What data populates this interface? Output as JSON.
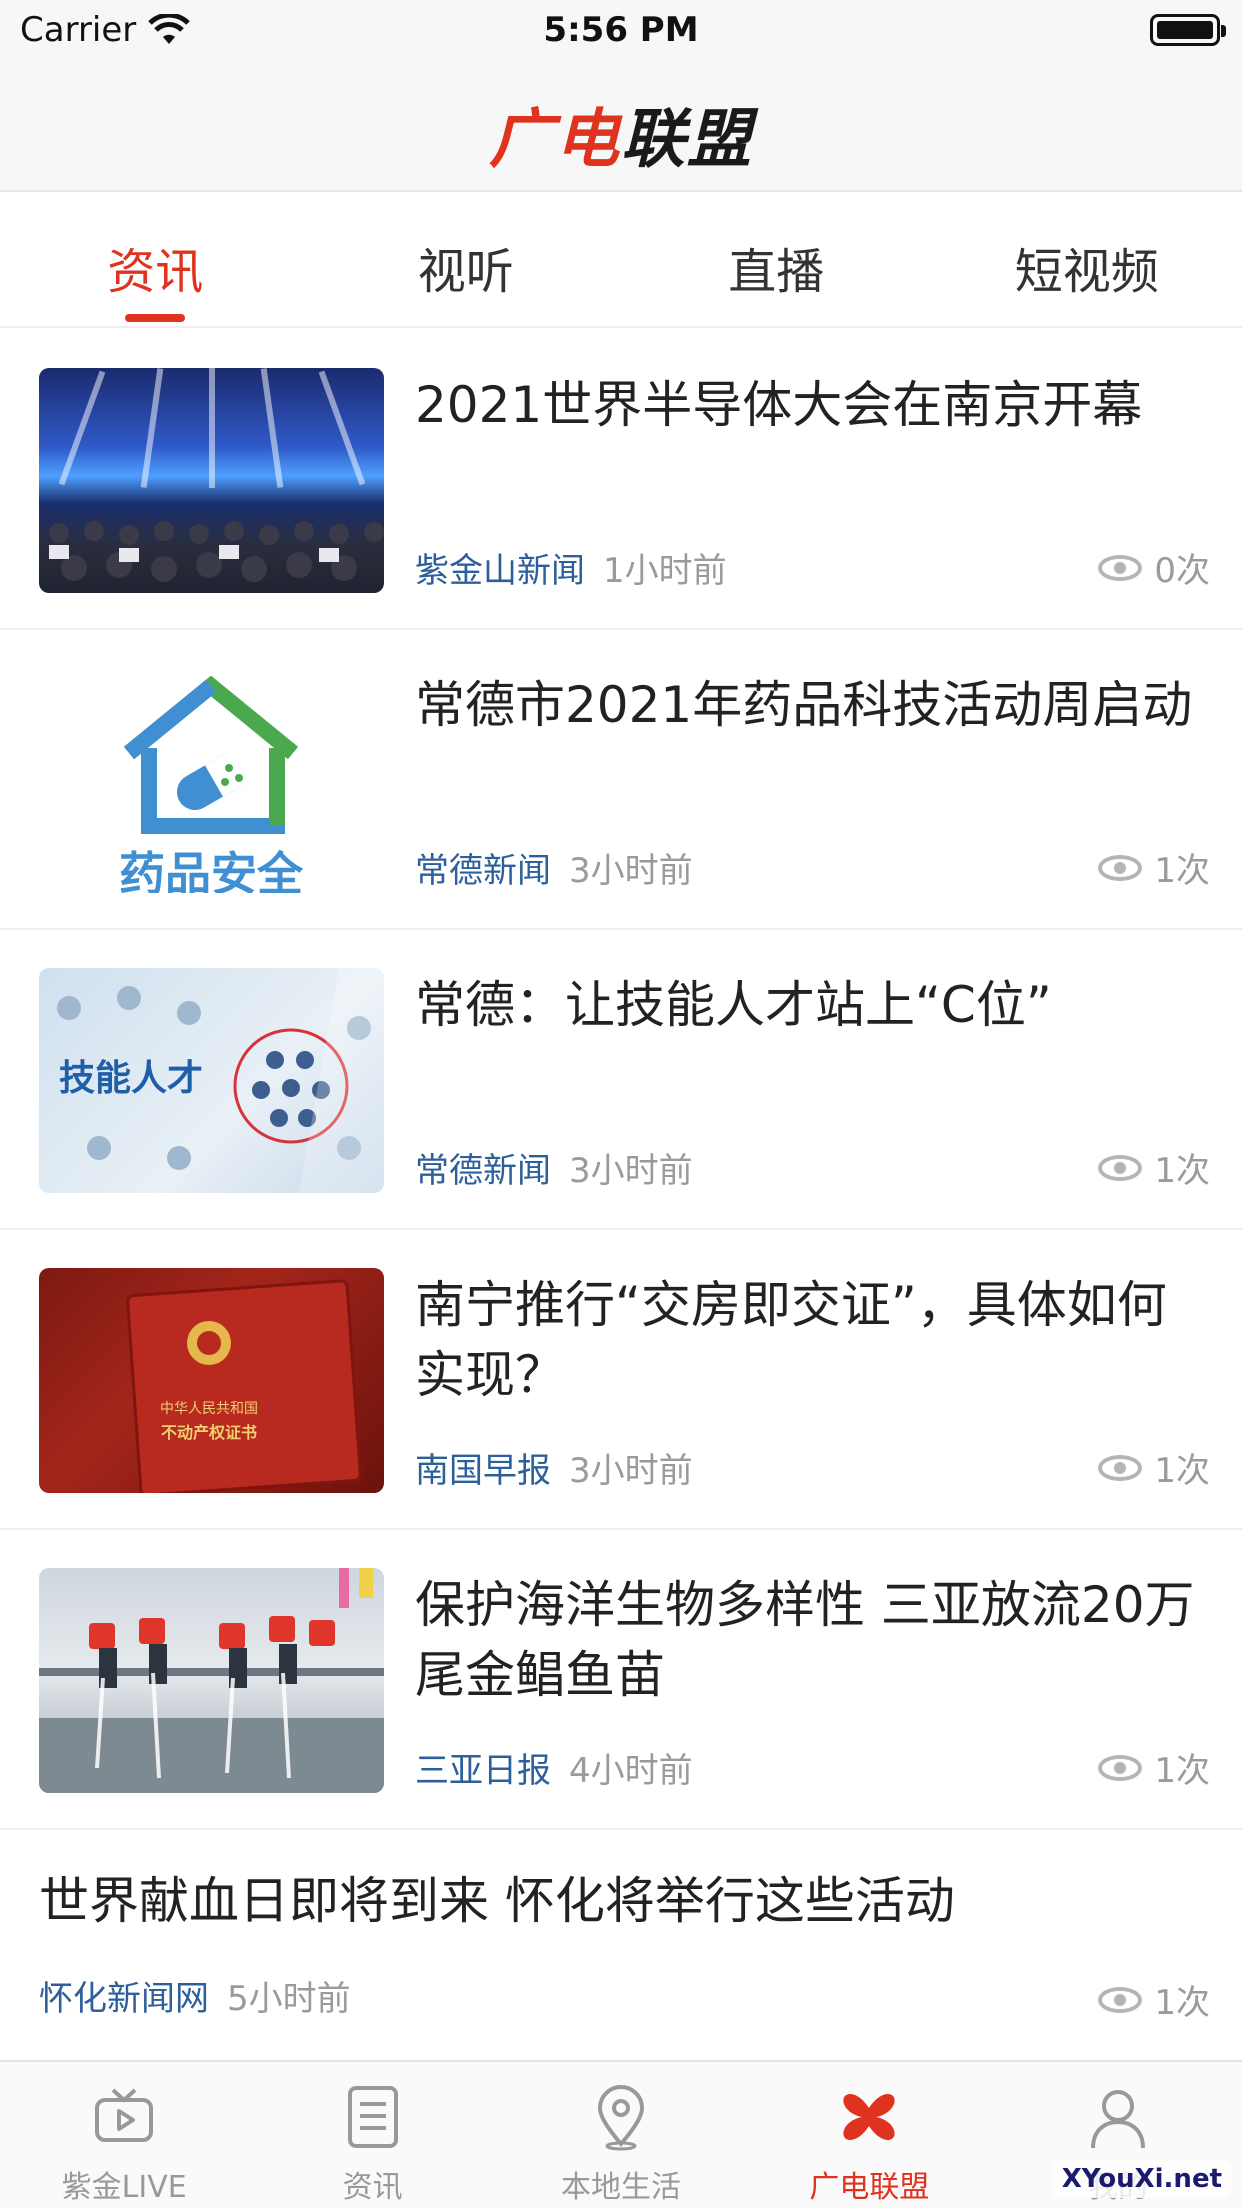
{
  "status_bar": {
    "carrier": "Carrier",
    "time": "5:56 PM"
  },
  "header": {
    "logo_red": "广电",
    "logo_dark": "联盟"
  },
  "tabs": [
    {
      "label": "资讯",
      "active": true
    },
    {
      "label": "视听",
      "active": false
    },
    {
      "label": "直播",
      "active": false
    },
    {
      "label": "短视频",
      "active": false
    }
  ],
  "feed": [
    {
      "title": "2021世界半导体大会在南京开幕",
      "source": "紫金山新闻",
      "time": "1小时前",
      "views": "0次"
    },
    {
      "title": "常德市2021年药品科技活动周启动",
      "source": "常德新闻",
      "time": "3小时前",
      "views": "1次",
      "thumb_text": "药品安全"
    },
    {
      "title": "常德：让技能人才站上“C位”",
      "source": "常德新闻",
      "time": "3小时前",
      "views": "1次",
      "thumb_text": "技能人才"
    },
    {
      "title": "南宁推行“交房即交证”，具体如何实现？",
      "source": "南国早报",
      "time": "3小时前",
      "views": "1次",
      "thumb_text_1": "中华人民共和国",
      "thumb_text_2": "不动产权证书"
    },
    {
      "title": "保护海洋生物多样性 三亚放流20万尾金鲳鱼苗",
      "source": "三亚日报",
      "time": "4小时前",
      "views": "1次"
    },
    {
      "title": "世界献血日即将到来 怀化将举行这些活动",
      "source": "怀化新闻网",
      "time": "5小时前",
      "views": "1次"
    }
  ],
  "tabbar": [
    {
      "label": "紫金LIVE",
      "icon": "tv-play-icon",
      "active": false
    },
    {
      "label": "资讯",
      "icon": "document-list-icon",
      "active": false
    },
    {
      "label": "本地生活",
      "icon": "location-pin-icon",
      "active": false
    },
    {
      "label": "广电联盟",
      "icon": "alliance-logo-icon",
      "active": true
    },
    {
      "label": "我的",
      "icon": "user-icon",
      "active": false
    }
  ],
  "watermark": "XYouXi.net",
  "colors": {
    "accent": "#e0331f",
    "source_blue": "#2d5f9a",
    "muted": "#9a9a9a"
  }
}
